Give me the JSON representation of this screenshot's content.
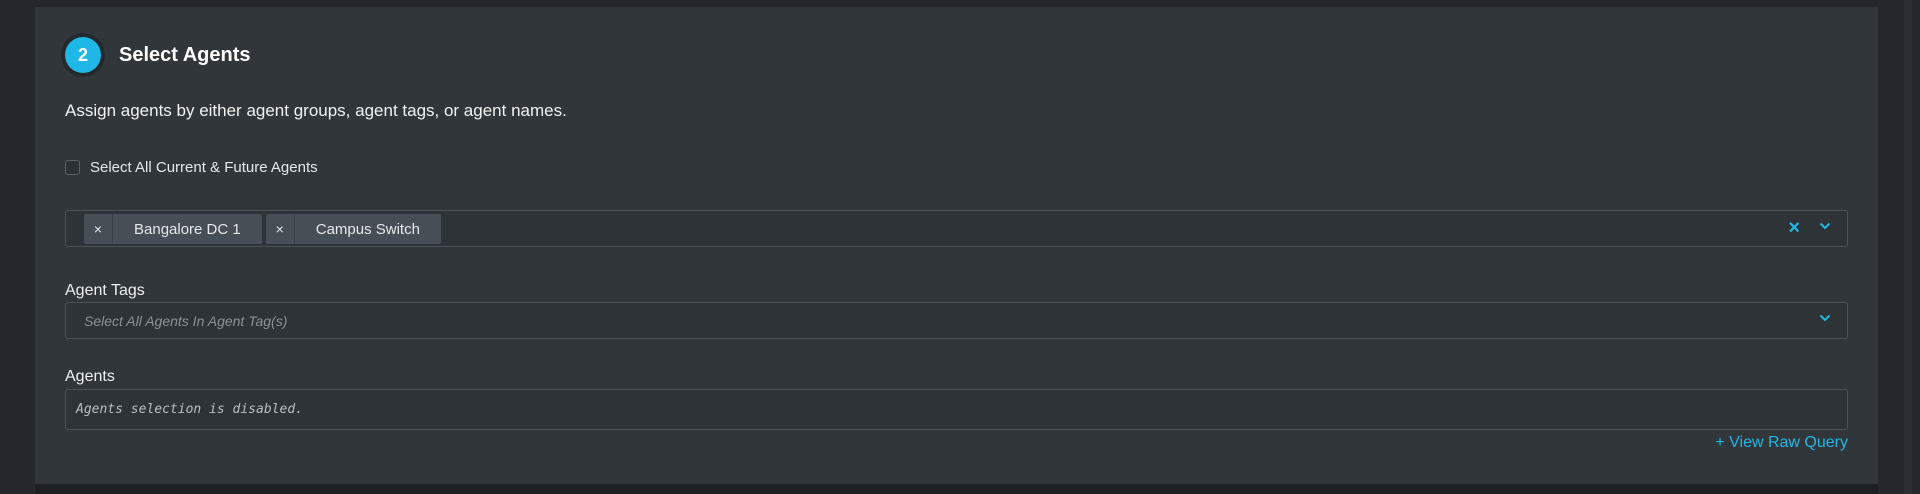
{
  "step": {
    "number": "2",
    "title": "Select Agents",
    "description": "Assign agents by either agent groups, agent tags, or agent names."
  },
  "select_all": {
    "label": "Select All Current & Future Agents",
    "checked": false
  },
  "agent_groups": {
    "chips": [
      {
        "remove_icon": "×",
        "label": "Bangalore DC 1"
      },
      {
        "remove_icon": "×",
        "label": "Campus Switch"
      }
    ],
    "clear_icon": "×"
  },
  "agent_tags": {
    "label": "Agent Tags",
    "placeholder": "Select All Agents In Agent Tag(s)"
  },
  "agents": {
    "label": "Agents",
    "disabled_message": "Agents selection is disabled."
  },
  "raw_query_link": "+ View Raw Query",
  "colors": {
    "accent": "#1fb8e6",
    "panel": "#30363a",
    "chip": "#474e55"
  }
}
